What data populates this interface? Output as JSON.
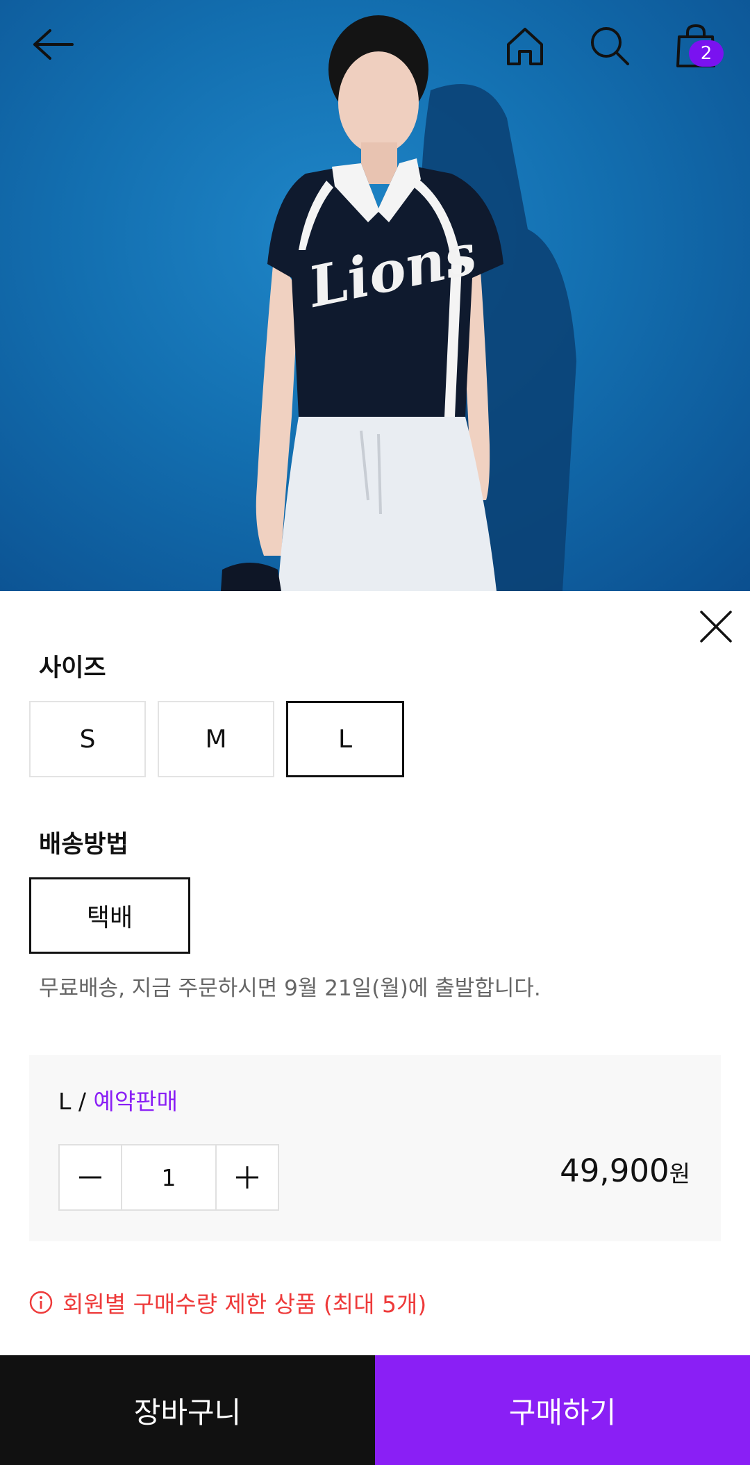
{
  "header": {
    "back_icon": "arrow-left-icon",
    "home_icon": "home-icon",
    "search_icon": "search-icon",
    "cart_icon": "shopping-bag-icon",
    "cart_count": "2"
  },
  "hero": {
    "jersey_text": "Lions",
    "accent": "#136fb0"
  },
  "sheet": {
    "close_icon": "close-icon",
    "size": {
      "title": "사이즈",
      "options": [
        "S",
        "M",
        "L"
      ],
      "selected": "L"
    },
    "shipping": {
      "title": "배송방법",
      "options": [
        "택배"
      ],
      "selected": "택배",
      "note": "무료배송, 지금 주문하시면 9월 21일(월)에 출발합니다."
    },
    "summary": {
      "option_label": "L /",
      "preorder_label": "예약판매",
      "quantity": "1",
      "price": "49,900",
      "currency": "원"
    },
    "limit_notice": "회원별 구매수량 제한 상품 (최대 5개)"
  },
  "actions": {
    "cart_label": "장바구니",
    "buy_label": "구매하기"
  },
  "colors": {
    "accent_purple": "#8a1ff5",
    "badge_purple": "#7a12f0",
    "warning_red": "#ee3a3a",
    "dark_button": "#111111"
  }
}
